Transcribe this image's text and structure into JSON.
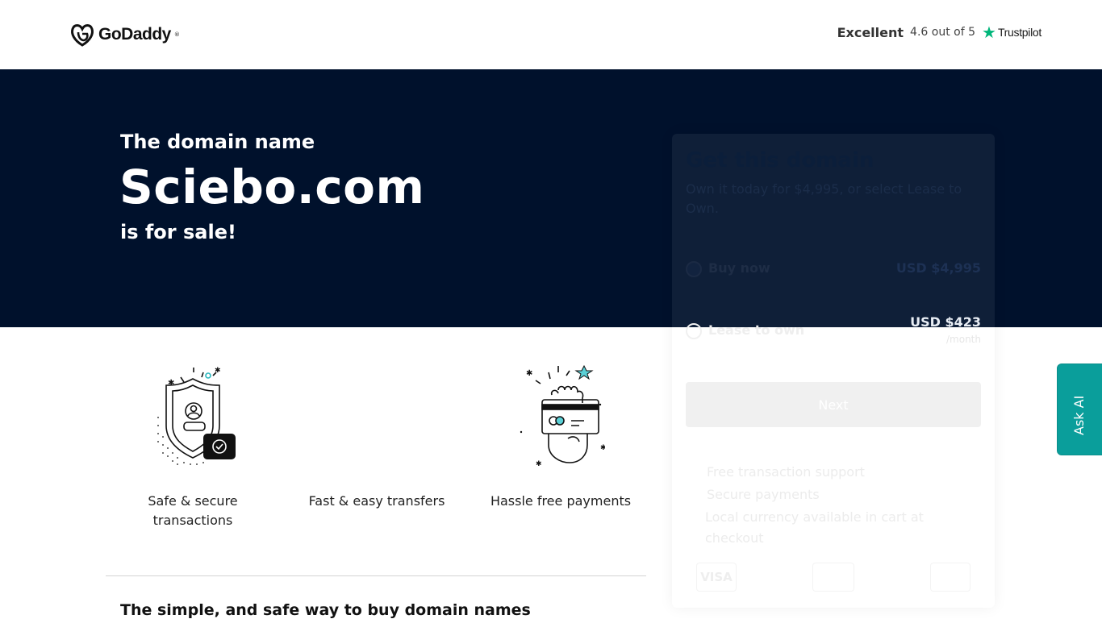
{
  "header": {
    "logo_text": "GoDaddy",
    "logo_tm": "®",
    "trust_word": "Excellent",
    "trust_score": "4.6 out of 5",
    "trust_brand": "Trustpilot",
    "trust_color": "#00b67a"
  },
  "hero": {
    "pre": "The domain name",
    "domain": "Sciebo.com",
    "post": "is for sale!",
    "background": "#00112c"
  },
  "card": {
    "title": "Get this domain",
    "subtitle": "Own it today for $4,995, or select Lease to Own.",
    "options": [
      {
        "label": "Buy now",
        "price": "USD $4,995",
        "unit": "",
        "selected": true
      },
      {
        "label": "Lease to own",
        "price": "USD $423",
        "unit": "/month",
        "selected": false
      }
    ],
    "next_label": "Next",
    "features": [
      "Free transaction support",
      "Secure payments",
      "Local currency available in cart at checkout"
    ],
    "payments": [
      "VISA",
      "",
      ""
    ]
  },
  "perks": [
    {
      "label": "Safe & secure transactions",
      "icon": "shield-check-icon"
    },
    {
      "label": "Fast & easy transfers",
      "icon": "transfer-icon"
    },
    {
      "label": "Hassle free payments",
      "icon": "card-hand-icon"
    }
  ],
  "bottom": {
    "title": "The simple, and safe way to buy domain names"
  },
  "ask_ai": {
    "label": "Ask AI",
    "color": "#0a9e9b"
  }
}
